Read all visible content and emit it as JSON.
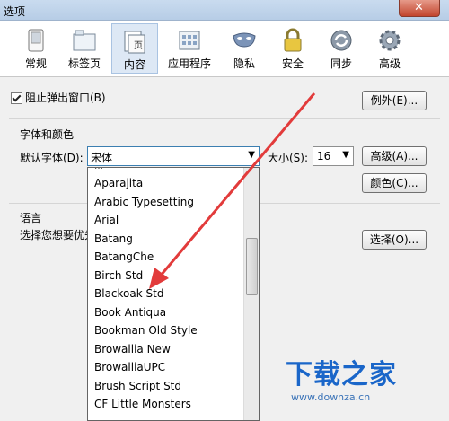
{
  "window": {
    "title": "选项",
    "close_label": "✕"
  },
  "toolbar": {
    "items": [
      {
        "label": "常规",
        "icon": "switch-icon"
      },
      {
        "label": "标签页",
        "icon": "tabs-icon"
      },
      {
        "label": "内容",
        "icon": "page-icon",
        "active": true
      },
      {
        "label": "应用程序",
        "icon": "apps-icon"
      },
      {
        "label": "隐私",
        "icon": "mask-icon"
      },
      {
        "label": "安全",
        "icon": "lock-icon"
      },
      {
        "label": "同步",
        "icon": "sync-icon"
      },
      {
        "label": "高级",
        "icon": "gear-icon"
      }
    ]
  },
  "content": {
    "block_popup_label": "阻止弹出窗口(B)",
    "block_popup_checked": true,
    "exceptions_button": "例外(E)...",
    "fonts_section_title": "字体和颜色",
    "default_font_label": "默认字体(D):",
    "default_font_value": "宋体",
    "size_label": "大小(S):",
    "size_value": "16",
    "advanced_button": "高级(A)...",
    "colors_button": "颜色(C)...",
    "language_section_title": "语言",
    "language_text": "选择您想要优先",
    "choose_button": "选择(O)..."
  },
  "font_list": {
    "items": [
      "Aparajita",
      "Arabic Typesetting",
      "Arial",
      "Batang",
      "BatangChe",
      "Birch Std",
      "Blackoak Std",
      "Book Antiqua",
      "Bookman Old Style",
      "Browallia New",
      "BrowalliaUPC",
      "Brush Script Std",
      "CF Little Monsters"
    ]
  },
  "watermark": {
    "title": "下载之家",
    "url": "www.downza.cn"
  },
  "colors": {
    "accent": "#1a66c9",
    "arrow": "#e23b3b"
  }
}
